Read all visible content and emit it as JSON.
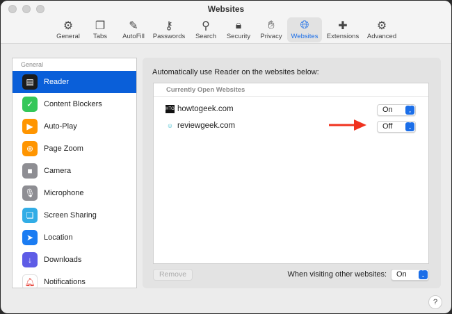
{
  "window": {
    "title": "Websites"
  },
  "toolbar": [
    {
      "label": "General",
      "icon": "gear-icon"
    },
    {
      "label": "Tabs",
      "icon": "tabs-icon"
    },
    {
      "label": "AutoFill",
      "icon": "autofill-icon"
    },
    {
      "label": "Passwords",
      "icon": "key-icon"
    },
    {
      "label": "Search",
      "icon": "search-icon"
    },
    {
      "label": "Security",
      "icon": "lock-icon"
    },
    {
      "label": "Privacy",
      "icon": "hand-icon"
    },
    {
      "label": "Websites",
      "icon": "globe-icon",
      "active": true
    },
    {
      "label": "Extensions",
      "icon": "puzzle-icon"
    },
    {
      "label": "Advanced",
      "icon": "gears-icon"
    }
  ],
  "sidebar": {
    "header": "General",
    "items": [
      {
        "label": "Reader",
        "color": "#1c1c1c",
        "selected": true
      },
      {
        "label": "Content Blockers",
        "color": "#34c759"
      },
      {
        "label": "Auto-Play",
        "color": "#ff9500"
      },
      {
        "label": "Page Zoom",
        "color": "#ff9500"
      },
      {
        "label": "Camera",
        "color": "#8e8e93"
      },
      {
        "label": "Microphone",
        "color": "#8e8e93"
      },
      {
        "label": "Screen Sharing",
        "color": "#32ade6"
      },
      {
        "label": "Location",
        "color": "#1b7cf2"
      },
      {
        "label": "Downloads",
        "color": "#5e5ce6"
      },
      {
        "label": "Notifications",
        "color": "#ffffff"
      }
    ]
  },
  "main": {
    "label": "Automatically use Reader on the websites below:",
    "table_header": "Currently Open Websites",
    "sites": [
      {
        "name": "howtogeek.com",
        "favicon": "HTG",
        "value": "On"
      },
      {
        "name": "reviewgeek.com",
        "favicon": "RG",
        "value": "Off"
      }
    ],
    "remove_label": "Remove",
    "other_label": "When visiting other websites:",
    "other_value": "On"
  },
  "help": "?"
}
